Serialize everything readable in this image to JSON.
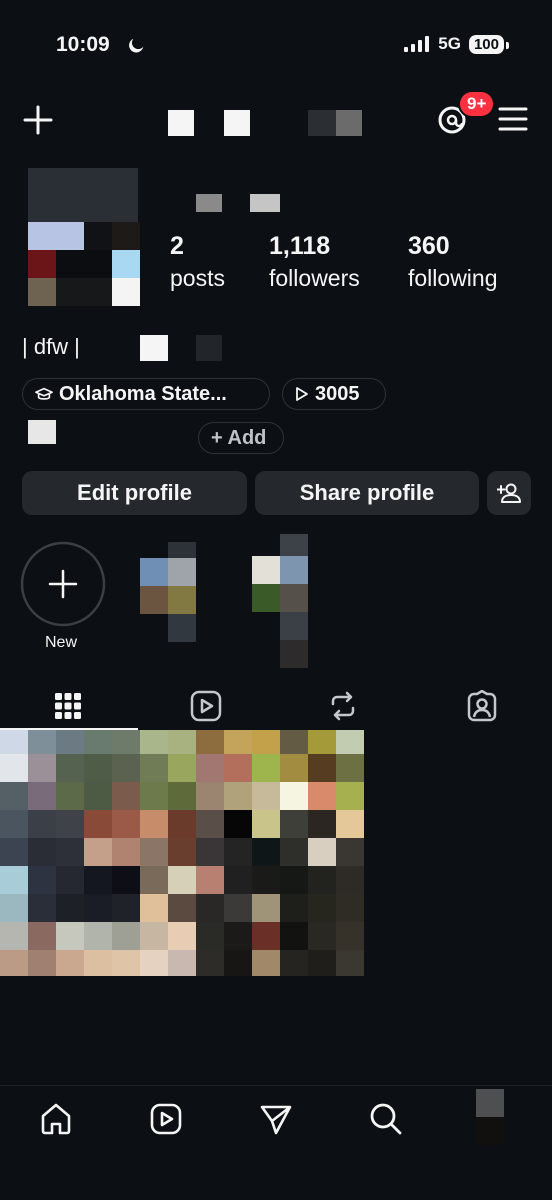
{
  "status": {
    "time": "10:09",
    "network": "5G",
    "battery": "100"
  },
  "header": {
    "threads_badge": "9+"
  },
  "profile": {
    "posts_count": "2",
    "posts_label": "posts",
    "followers_count": "1,118",
    "followers_label": "followers",
    "following_count": "360",
    "following_label": "following",
    "bio_line": "| dfw |",
    "school_chip": "Oklahoma State...",
    "threads_chip": "3005",
    "add_link_label": "+ Add"
  },
  "actions": {
    "edit_label": "Edit profile",
    "share_label": "Share profile"
  },
  "highlights": {
    "new_label": "New"
  },
  "colors": {
    "background": "#0c1014",
    "button": "#25292e",
    "badge": "#ff3040"
  },
  "icons": [
    "plus-icon",
    "threads-icon",
    "menu-icon",
    "graduation-cap-icon",
    "play-icon",
    "add-person-icon",
    "grid-icon",
    "reels-icon",
    "repost-icon",
    "tagged-icon",
    "home-icon",
    "send-icon",
    "search-icon"
  ]
}
